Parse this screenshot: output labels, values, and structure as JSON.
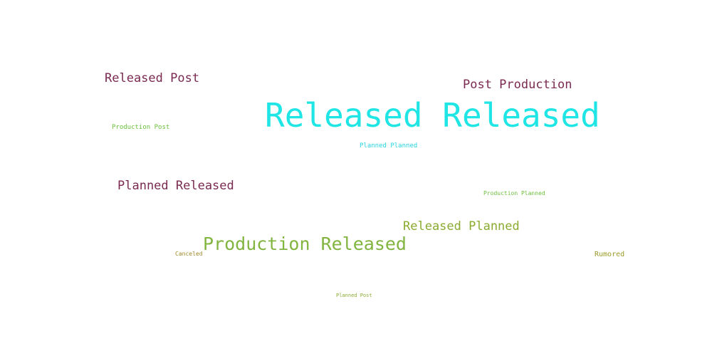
{
  "words": [
    {
      "text": "Released Released",
      "color": "#1fe5e5"
    },
    {
      "text": "Production Released",
      "color": "#82b440"
    },
    {
      "text": "Post Production",
      "color": "#7a2a50"
    },
    {
      "text": "Released Post",
      "color": "#7a2a50"
    },
    {
      "text": "Planned Released",
      "color": "#7a2a50"
    },
    {
      "text": "Released Planned",
      "color": "#8aaa30"
    },
    {
      "text": "Production Post",
      "color": "#6bbf3c"
    },
    {
      "text": "Planned Planned",
      "color": "#27d4e0"
    },
    {
      "text": "Production Planned",
      "color": "#6bbf3c"
    },
    {
      "text": "Rumored",
      "color": "#9a9a2a"
    },
    {
      "text": "Canceled",
      "color": "#a08a2a"
    },
    {
      "text": "Planned Post",
      "color": "#8aaa30"
    }
  ]
}
